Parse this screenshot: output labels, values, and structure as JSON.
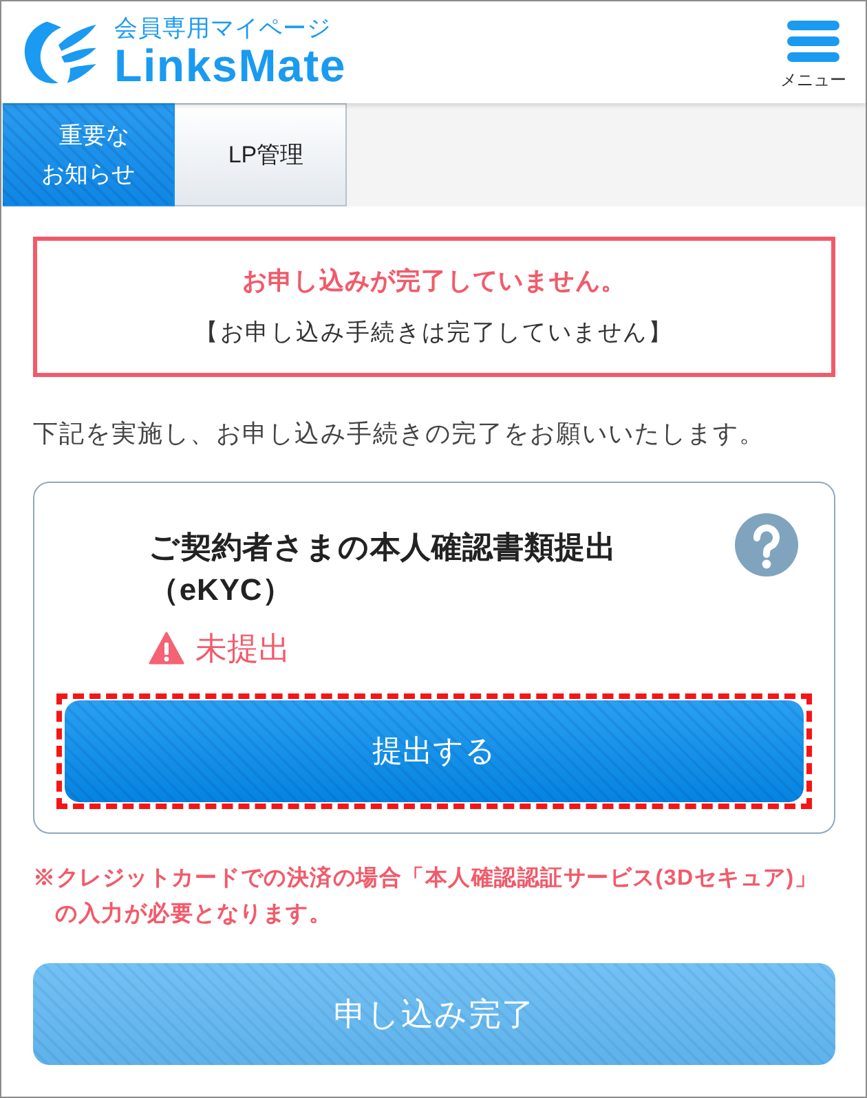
{
  "header": {
    "logo_caption": "会員専用マイページ",
    "logo_name": "LinksMate",
    "menu_label": "メニュー"
  },
  "tabs": [
    {
      "label": "重要なお知らせ",
      "selected": true
    },
    {
      "label": "LP管理",
      "selected": false
    }
  ],
  "alert": {
    "title": "お申し込みが完了していません。",
    "message": "【お申し込み手続きは完了していません】"
  },
  "intro": "下記を実施し、お申し込み手続きの完了をお願いいたします。",
  "task": {
    "title": "ご契約者さまの本人確認書類提出（eKYC）",
    "status": "未提出",
    "action": "提出する",
    "highlighted": true
  },
  "note": "※クレジットカードでの決済の場合「本人確認認証サービス(3Dセキュア)」の入力が必要となります。",
  "complete_button": {
    "label": "申し込み完了",
    "disabled": true
  }
}
